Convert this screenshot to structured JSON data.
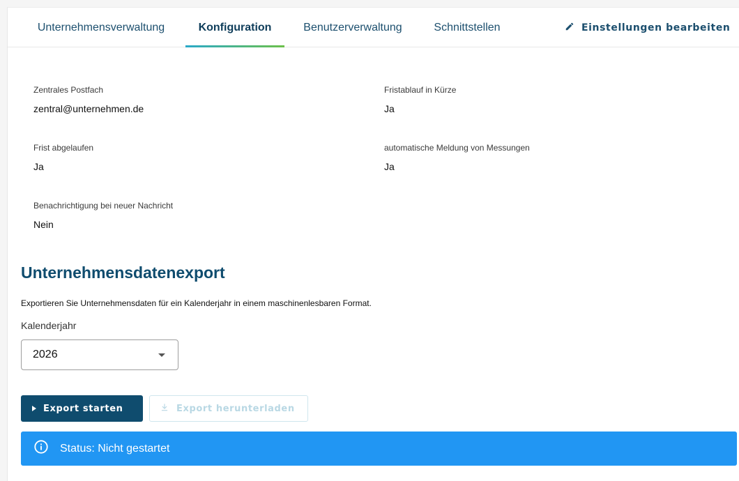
{
  "tabs": [
    {
      "label": "Unternehmensverwaltung",
      "active": false
    },
    {
      "label": "Konfiguration",
      "active": true
    },
    {
      "label": "Benutzerverwaltung",
      "active": false
    },
    {
      "label": "Schnittstellen",
      "active": false
    }
  ],
  "edit_action": {
    "label": "Einstellungen bearbeiten",
    "icon": "pencil-icon"
  },
  "config": {
    "central_mailbox": {
      "label": "Zentrales Postfach",
      "value": "zentral@unternehmen.de"
    },
    "deadline_soon": {
      "label": "Fristablauf in Kürze",
      "value": "Ja"
    },
    "deadline_expired": {
      "label": "Frist abgelaufen",
      "value": "Ja"
    },
    "auto_report": {
      "label": "automatische Meldung von Messungen",
      "value": "Ja"
    },
    "new_message_notify": {
      "label": "Benachrichtigung bei neuer Nachricht",
      "value": "Nein"
    }
  },
  "export": {
    "title": "Unternehmensdatenexport",
    "description": "Exportieren Sie Unternehmensdaten für ein Kalenderjahr in einem maschinenlesbaren Format.",
    "year_label": "Kalenderjahr",
    "year_value": "2026",
    "start_label": "Export starten",
    "download_label": "Export herunterladen",
    "status_text": "Status: Nicht gestartet"
  },
  "colors": {
    "primary": "#0f4c6e",
    "status_info": "#2196f3",
    "tab_accent_start": "#2aa9c9",
    "tab_accent_end": "#6cc04a"
  }
}
